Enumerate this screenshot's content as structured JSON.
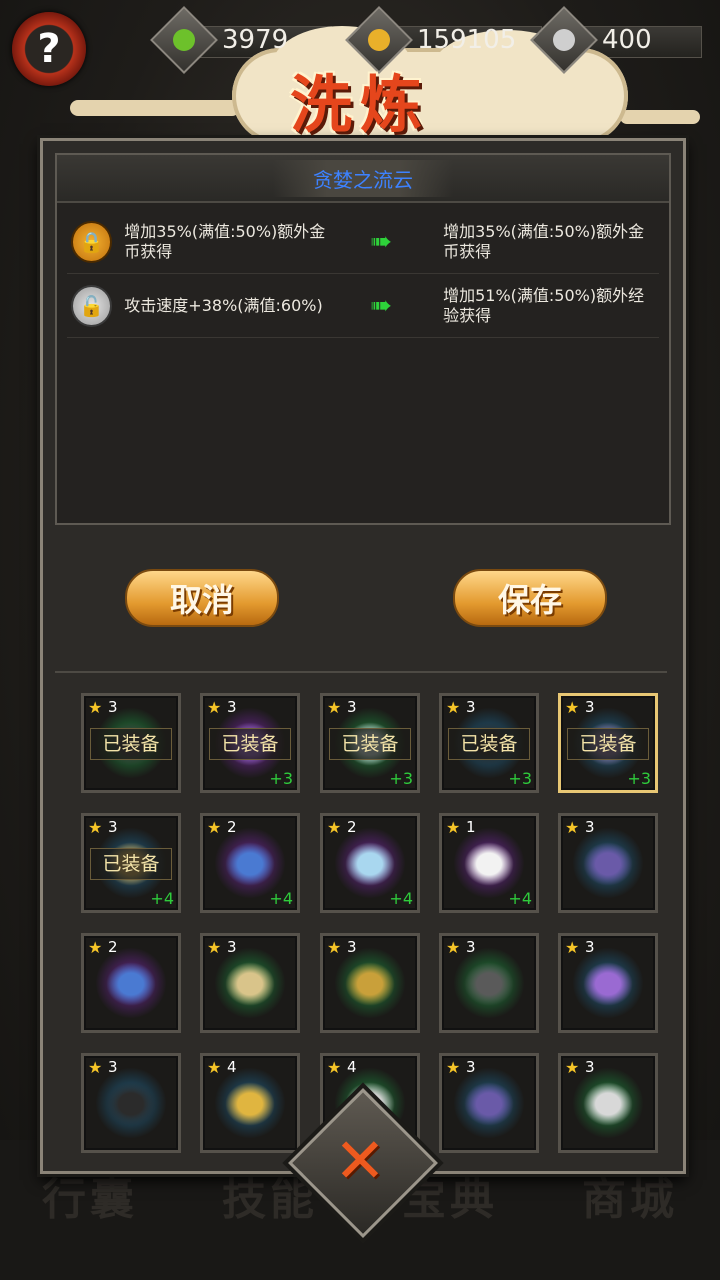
{
  "topbar": {
    "help_label": "?",
    "resources": [
      {
        "name": "jade",
        "icon": "green-gem-icon",
        "value": "3979",
        "color": "#6dc12b"
      },
      {
        "name": "gold",
        "icon": "gold-coin-icon",
        "value": "159105",
        "color": "#e9b02a"
      },
      {
        "name": "silver",
        "icon": "silver-orb-icon",
        "value": "400",
        "color": "#cfcfcf"
      }
    ]
  },
  "title": "洗炼",
  "item_name": "贪婪之流云",
  "attributes": [
    {
      "lock": "locked",
      "current": "增加35%(满值:50%)额外金币获得",
      "arrow": "➠",
      "new": "增加35%(满值:50%)额外金币获得"
    },
    {
      "lock": "unlocked",
      "current": "攻击速度+38%(满值:60%)",
      "arrow": "➠",
      "new": "增加51%(满值:50%)额外经验获得"
    }
  ],
  "buttons": {
    "cancel": "取消",
    "save": "保存"
  },
  "equipped_label": "已装备",
  "bottom_tabs": [
    "行囊",
    "技能",
    "宝典",
    "商城"
  ],
  "close_label": "✕",
  "grid": [
    {
      "stars": "3",
      "plus": "",
      "equipped": true,
      "selected": false,
      "item": "dark-mask",
      "glow": "#1e6a34"
    },
    {
      "stars": "3",
      "plus": "+3",
      "equipped": true,
      "selected": false,
      "item": "purple-amulet",
      "glow": "#5b2478"
    },
    {
      "stars": "3",
      "plus": "+3",
      "equipped": true,
      "selected": false,
      "item": "sword",
      "glow": "#1e6a34"
    },
    {
      "stars": "3",
      "plus": "+3",
      "equipped": true,
      "selected": false,
      "item": "hat",
      "glow": "#1f4f6a"
    },
    {
      "stars": "3",
      "plus": "+3",
      "equipped": true,
      "selected": true,
      "item": "bracelet",
      "glow": "#1f4f6a"
    },
    {
      "stars": "3",
      "plus": "+4",
      "equipped": true,
      "selected": false,
      "item": "ring",
      "glow": "#1f4f6a"
    },
    {
      "stars": "2",
      "plus": "+4",
      "equipped": false,
      "selected": false,
      "item": "blue-bracelet",
      "glow": "#5b2478"
    },
    {
      "stars": "2",
      "plus": "+4",
      "equipped": false,
      "selected": false,
      "item": "blue-sword",
      "glow": "#5b2478"
    },
    {
      "stars": "1",
      "plus": "+4",
      "equipped": false,
      "selected": false,
      "item": "fox-mask",
      "glow": "#5b2478"
    },
    {
      "stars": "3",
      "plus": "",
      "equipped": false,
      "selected": false,
      "item": "purple-ring",
      "glow": "#1f4f6a"
    },
    {
      "stars": "2",
      "plus": "",
      "equipped": false,
      "selected": false,
      "item": "blue-bracelet",
      "glow": "#5b2478"
    },
    {
      "stars": "3",
      "plus": "",
      "equipped": false,
      "selected": false,
      "item": "fang-necklace",
      "glow": "#1e6a34"
    },
    {
      "stars": "3",
      "plus": "",
      "equipped": false,
      "selected": false,
      "item": "gold-ring",
      "glow": "#1e6a34"
    },
    {
      "stars": "3",
      "plus": "",
      "equipped": false,
      "selected": false,
      "item": "gray-mask",
      "glow": "#1e6a34"
    },
    {
      "stars": "3",
      "plus": "",
      "equipped": false,
      "selected": false,
      "item": "purple-amulet",
      "glow": "#1f4f6a"
    },
    {
      "stars": "3",
      "plus": "",
      "equipped": false,
      "selected": false,
      "item": "dark-hat",
      "glow": "#1f4f6a"
    },
    {
      "stars": "4",
      "plus": "",
      "equipped": false,
      "selected": false,
      "item": "gold-bracelet",
      "glow": "#1f4f6a"
    },
    {
      "stars": "4",
      "plus": "",
      "equipped": false,
      "selected": false,
      "item": "dagger",
      "glow": "#1e6a34"
    },
    {
      "stars": "3",
      "plus": "",
      "equipped": false,
      "selected": false,
      "item": "purple-ring",
      "glow": "#1f4f6a"
    },
    {
      "stars": "3",
      "plus": "",
      "equipped": false,
      "selected": false,
      "item": "knife",
      "glow": "#1e6a34"
    }
  ]
}
